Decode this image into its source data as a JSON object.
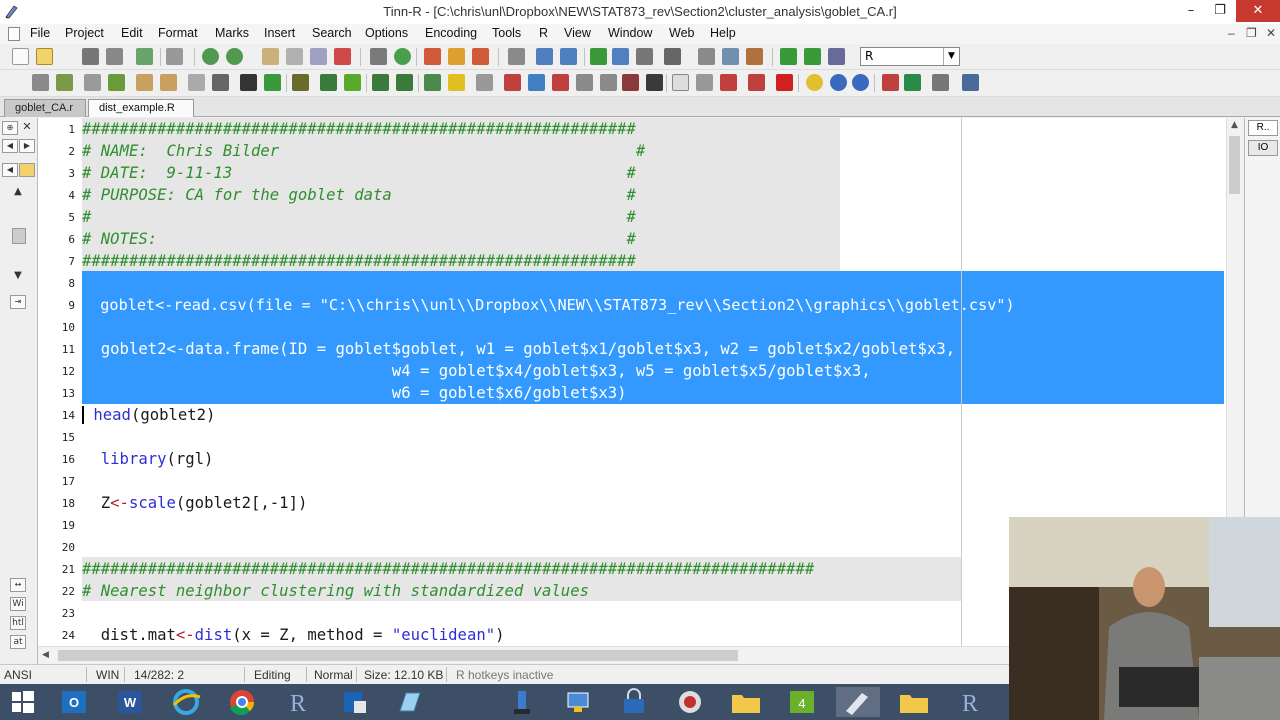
{
  "window": {
    "title": "Tinn-R - [C:\\chris\\unl\\Dropbox\\NEW\\STAT873_rev\\Section2\\cluster_analysis\\goblet_CA.r]"
  },
  "menus": [
    "File",
    "Project",
    "Edit",
    "Format",
    "Marks",
    "Insert",
    "Search",
    "Options",
    "Encoding",
    "Tools",
    "R",
    "View",
    "Window",
    "Web",
    "Help"
  ],
  "toolbar": {
    "language_combo": "R"
  },
  "tabs": [
    {
      "label": "goblet_CA.r"
    },
    {
      "label": "dist_example.R"
    }
  ],
  "editor": {
    "line_numbers": [
      "1",
      "2",
      "3",
      "4",
      "5",
      "6",
      "7",
      "8",
      "9",
      "10",
      "11",
      "12",
      "13",
      "14",
      "15",
      "16",
      "17",
      "18",
      "19",
      "20",
      "21",
      "22",
      "23",
      "24"
    ],
    "header_hashes": "###########################################################",
    "line2": "# NAME:  Chris Bilder                                      #",
    "line3": "# DATE:  9-11-13                                          #",
    "line4": "# PURPOSE: CA for the goblet data                         #",
    "line5": "#                                                         #",
    "line6": "# NOTES:                                                  #",
    "line9": "  goblet<-read.csv(file = \"C:\\\\chris\\\\unl\\\\Dropbox\\\\NEW\\\\STAT873_rev\\\\Section2\\\\graphics\\\\goblet.csv\")",
    "line11": "  goblet2<-data.frame(ID = goblet$goblet, w1 = goblet$x1/goblet$x3, w2 = goblet$x2/goblet$x3,",
    "line12": "                                 w4 = goblet$x4/goblet$x3, w5 = goblet$x5/goblet$x3,",
    "line13": "                                 w6 = goblet$x6/goblet$x3)",
    "line14_fn": "head",
    "line14_rest": "(goblet2)",
    "line16_fn": "library",
    "line16_rest": "(rgl)",
    "line18_a": "Z",
    "line18_op": "<-",
    "line18_fn": "scale",
    "line18_rest": "(goblet2[,-1])",
    "section_hashes": "##############################################################################",
    "line22": "# Nearest neighbor clustering with standardized values",
    "line24_a": "dist.mat",
    "line24_op": "<-",
    "line24_fn": "dist",
    "line24_b": "(x = Z, method = ",
    "line24_str": "\"euclidean\"",
    "line24_c": ")"
  },
  "left_panel": {
    "labels": [
      "Wi",
      "htl",
      "at"
    ]
  },
  "right_panel": {
    "tab_r": "R..",
    "tab_io": "IO"
  },
  "status": {
    "encoding": "ANSI",
    "eol": "WIN",
    "position": "14/282: 2",
    "mode": "Editing",
    "insert": "Normal",
    "size": "Size: 12.10 KB",
    "hotkeys": "R hotkeys inactive"
  },
  "taskbar": {
    "items": [
      "start-button",
      "outlook-icon",
      "word-icon",
      "ie-icon",
      "chrome-icon",
      "r-icon",
      "app-icon",
      "notepad-icon",
      "usb-icon",
      "network-icon",
      "lock-icon",
      "snip-icon",
      "folder-icon",
      "dreamweaver-icon",
      "tinnr-icon",
      "folder2-icon",
      "rgui-icon"
    ]
  },
  "colors": {
    "selection": "#3399ff",
    "comment": "#2f8f2f",
    "function": "#2e2ed6",
    "operator": "#b82121",
    "taskbar": "#3d4e67"
  }
}
